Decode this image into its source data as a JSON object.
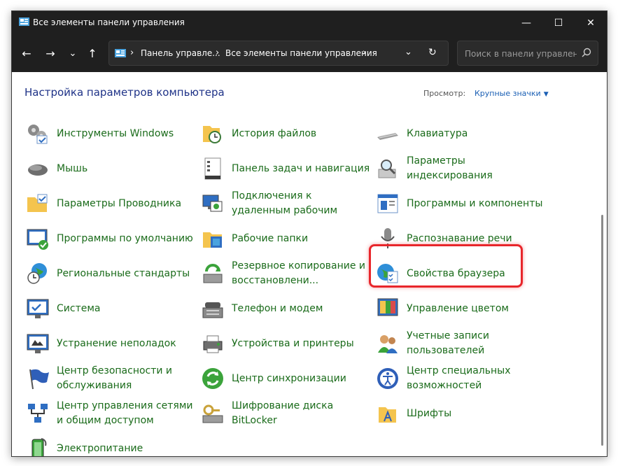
{
  "window": {
    "title": "Все элементы панели управления",
    "minimize": "—",
    "maximize": "☐",
    "close": "✕"
  },
  "nav": {
    "back": "←",
    "forward": "→",
    "recent": "⌄",
    "up": "↑",
    "breadcrumb": [
      "Панель управле...",
      "Все элементы панели управления"
    ],
    "dropdown": "⌄",
    "refresh": "↻",
    "search_placeholder": "Поиск в панели управления"
  },
  "header": {
    "title": "Настройка параметров компьютера",
    "view_label": "Просмотр:",
    "view_value": "Крупные значки"
  },
  "items": [
    {
      "label": "Инструменты Windows",
      "icon": "windows-tools-icon"
    },
    {
      "label": "История файлов",
      "icon": "file-history-icon"
    },
    {
      "label": "Клавиатура",
      "icon": "keyboard-icon"
    },
    {
      "label": "Мышь",
      "icon": "mouse-icon"
    },
    {
      "label": "Панель задач и навигация",
      "icon": "taskbar-icon"
    },
    {
      "label": "Параметры индексирования",
      "icon": "indexing-icon"
    },
    {
      "label": "Параметры Проводника",
      "icon": "explorer-options-icon"
    },
    {
      "label": "Подключения к удаленным рабочим",
      "icon": "remote-desktop-icon"
    },
    {
      "label": "Программы и компоненты",
      "icon": "programs-icon"
    },
    {
      "label": "Программы по умолчанию",
      "icon": "default-programs-icon"
    },
    {
      "label": "Рабочие папки",
      "icon": "work-folders-icon"
    },
    {
      "label": "Распознавание речи",
      "icon": "microphone-icon"
    },
    {
      "label": "Региональные стандарты",
      "icon": "region-icon"
    },
    {
      "label": "Резервное копирование и восстановлени...",
      "icon": "backup-icon"
    },
    {
      "label": "Свойства браузера",
      "icon": "internet-options-icon"
    },
    {
      "label": "Система",
      "icon": "system-icon"
    },
    {
      "label": "Телефон и модем",
      "icon": "phone-modem-icon"
    },
    {
      "label": "Управление цветом",
      "icon": "color-management-icon"
    },
    {
      "label": "Устранение неполадок",
      "icon": "troubleshooting-icon"
    },
    {
      "label": "Устройства и принтеры",
      "icon": "devices-printers-icon"
    },
    {
      "label": "Учетные записи пользователей",
      "icon": "user-accounts-icon"
    },
    {
      "label": "Центр безопасности и обслуживания",
      "icon": "security-center-icon"
    },
    {
      "label": "Центр синхронизации",
      "icon": "sync-center-icon"
    },
    {
      "label": "Центр специальных возможностей",
      "icon": "accessibility-icon"
    },
    {
      "label": "Центр управления сетями и общим доступом",
      "icon": "network-center-icon"
    },
    {
      "label": "Шифрование диска BitLocker",
      "icon": "bitlocker-icon"
    },
    {
      "label": "Шрифты",
      "icon": "fonts-icon"
    },
    {
      "label": "Электропитание",
      "icon": "power-options-icon"
    }
  ],
  "colors": {
    "link_green": "#1a6b1a",
    "heading_blue": "#1e3287",
    "highlight_red": "#e8262b",
    "titlebar": "#1f1f1f"
  }
}
